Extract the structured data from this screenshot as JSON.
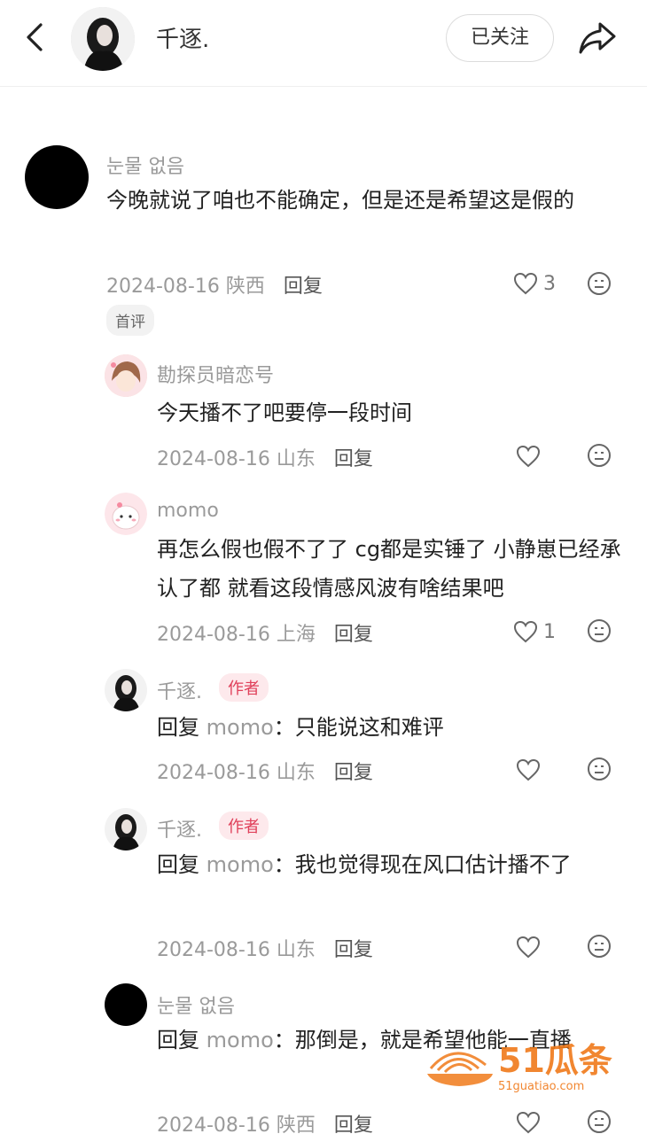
{
  "header": {
    "name": "千逐.",
    "follow_label": "已关注"
  },
  "comments": [
    {
      "username": "눈물 없음",
      "text": "今晚就说了咱也不能确定，但是还是希望这是假的",
      "date": "2024-08-16",
      "location": "陕西",
      "reply_label": "回复",
      "likes": "3",
      "badge": "首评"
    }
  ],
  "replies": [
    {
      "username": "勘探员暗恋号",
      "text": "今天播不了吧要停一段时间",
      "date": "2024-08-16",
      "location": "山东",
      "reply_label": "回复",
      "likes": ""
    },
    {
      "username": "momo",
      "text": "再怎么假也假不了了 cg都是实锤了 小静崽已经承认了都 就看这段情感风波有啥结果吧",
      "date": "2024-08-16",
      "location": "上海",
      "reply_label": "回复",
      "likes": "1"
    },
    {
      "username": "千逐.",
      "author_tag": "作者",
      "reply_prefix": "回复",
      "reply_target": "momo",
      "reply_colon": "：",
      "text": "只能说这和难评",
      "date": "2024-08-16",
      "location": "山东",
      "reply_label": "回复",
      "likes": ""
    },
    {
      "username": "千逐.",
      "author_tag": "作者",
      "reply_prefix": "回复",
      "reply_target": "momo",
      "reply_colon": "：",
      "text": "我也觉得现在风口估计播不了",
      "date": "2024-08-16",
      "location": "山东",
      "reply_label": "回复",
      "likes": ""
    },
    {
      "username": "눈물 없음",
      "reply_prefix": "回复",
      "reply_target": "momo",
      "reply_colon": "：",
      "text": "那倒是，就是希望他能一直播",
      "date": "2024-08-16",
      "location": "陕西",
      "reply_label": "回复",
      "likes": ""
    }
  ],
  "icons": {
    "back": "chevron-left-icon",
    "share": "share-arrow-icon",
    "like": "heart-outline-icon",
    "emoji": "emoji-face-icon"
  },
  "watermark": {
    "logo_text": "51瓜条",
    "site": "51guatiao.com",
    "color": "#f07a1a"
  },
  "colors": {
    "author_tag_text": "#e0405a",
    "author_tag_bg": "#fde9ec",
    "meta_gray": "#9a9a9a"
  }
}
